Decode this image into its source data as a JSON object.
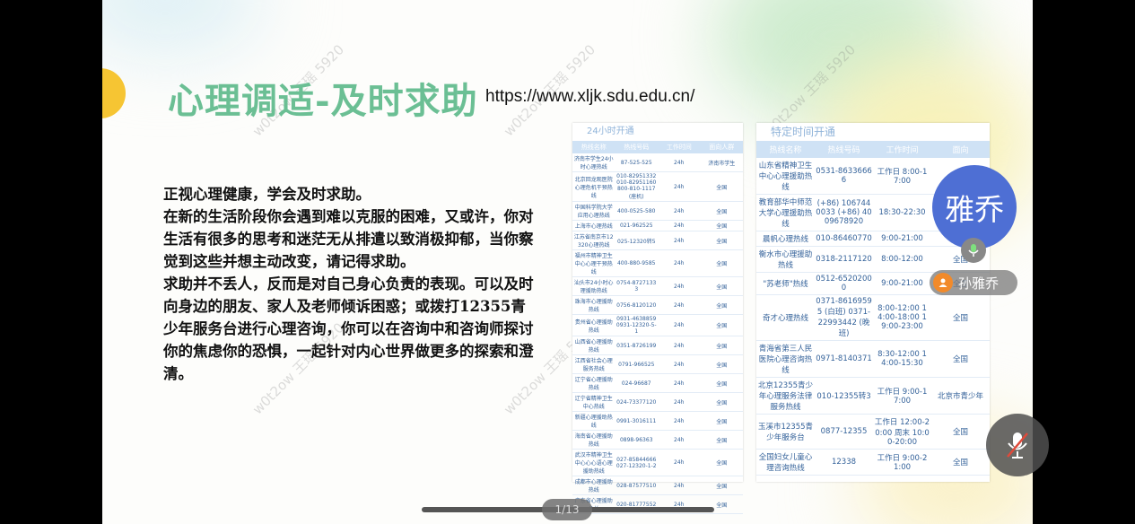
{
  "slide": {
    "title": "心理调适-及时求助",
    "url": "https://www.xljk.sdu.edu.cn/",
    "paragraphs": [
      "正视心理健康，学会及时求助。",
      "在新的生活阶段你会遇到难以克服的困难，又或许，你对生活有很多的思考和迷茫无从排遣以致消极抑郁，当你察觉到这些并想主动改变，请记得求助。",
      "求助并不丢人，反而是对自己身心负责的表现。可以及时向身边的朋友、家人及老师倾诉困惑；或拨打12355青少年服务台进行心理咨询，你可以在咨询中和咨询师探讨你的焦虑你的恐惧，一起针对内心世界做更多的探索和澄清。"
    ],
    "watermark": "w0t2ow 王瑶 5920"
  },
  "table1": {
    "heading": "24小时开通",
    "headers": [
      "热线名称",
      "热线号码",
      "工作时间",
      "面向人群"
    ],
    "rows": [
      [
        "济南市学生24小时心理热线",
        "87-525-525",
        "24h",
        "济南市学生"
      ],
      [
        "北京回龙观医院心理危机干预热线",
        "010-82951332 010-82951160 800-810-1117(座机)",
        "24h",
        "全国"
      ],
      [
        "中国科学院大学应用心理热线",
        "400-0525-580",
        "24h",
        "全国"
      ],
      [
        "上海市心理热线",
        "021-962525",
        "24h",
        "全国"
      ],
      [
        "江苏省南京市12320心理热线",
        "025-12320转5",
        "24h",
        "全国"
      ],
      [
        "福州市精神卫生中心心理干预热线",
        "400-880-9585",
        "24h",
        "全国"
      ],
      [
        "汕头市24小时心理援助热线",
        "0754-87271333",
        "24h",
        "全国"
      ],
      [
        "珠海市心理援助热线",
        "0756-8120120",
        "24h",
        "全国"
      ],
      [
        "贵州省心理援助热线",
        "0931-4638859 0931-12320-5-1",
        "24h",
        "全国"
      ],
      [
        "山西省心理援助热线",
        "0351-8726199",
        "24h",
        "全国"
      ],
      [
        "江西省社会心理服务热线",
        "0791-966525",
        "24h",
        "全国"
      ],
      [
        "辽宁省心理援助热线",
        "024-96687",
        "24h",
        "全国"
      ],
      [
        "辽宁省精神卫生中心热线",
        "024-73377120",
        "24h",
        "全国"
      ],
      [
        "新疆心理援助热线",
        "0991-3016111",
        "24h",
        "全国"
      ],
      [
        "海南省心理援助热线",
        "0898-96363",
        "24h",
        "全国"
      ],
      [
        "武汉市精神卫生中心心心语心理援助热线",
        "027-85844666 027-12320-1-2",
        "24h",
        "全国"
      ],
      [
        "成都市心理援助热线",
        "028-87577510",
        "24h",
        "全国"
      ],
      [
        "广东省心理援助公益",
        "020-81777552",
        "24h",
        "全国"
      ]
    ]
  },
  "table2": {
    "heading": "特定时间开通",
    "headers": [
      "热线名称",
      "热线号码",
      "工作时间",
      "面向"
    ],
    "rows": [
      [
        "山东省精神卫生中心心理援助热线",
        "0531-86336666",
        "工作日 8:00-17:00",
        "全国"
      ],
      [
        "教育部华中师范大学心理援助热线",
        "(+86) 1067440033 (+86) 4009678920",
        "18:30-22:30",
        "全国"
      ],
      [
        "晨帆心理热线",
        "010-86460770",
        "9:00-21:00",
        "全国"
      ],
      [
        "衡水市心理援助热线",
        "0318-2117120",
        "8:00-12:00",
        "全国"
      ],
      [
        "\"苏老师\"热线",
        "0512-65202000",
        "9:00-21:00",
        "全国"
      ],
      [
        "奇才心理热线",
        "0371-86169595 (白班) 0371-22993442 (晚班)",
        "8:00-12:00 14:00-18:00 19:00-23:00",
        "全国"
      ],
      [
        "青海省第三人民医院心理咨询热线",
        "0971-8140371",
        "8:30-12:00 14:00-15:30",
        "全国"
      ],
      [
        "北京12355青少年心理服务法律服务热线",
        "010-12355转3",
        "工作日 9:00-17:00",
        "北京市青少年"
      ],
      [
        "玉溪市12355青少年服务台",
        "0877-12355",
        "工作日 12:00-20:00 周末 10:00-20:00",
        "全国"
      ],
      [
        "全国妇女儿童心理咨询热线",
        "12338",
        "工作日 9:00-21:00",
        "全国"
      ]
    ]
  },
  "overlay": {
    "avatar_text": "雅乔",
    "participant_name": "孙雅乔",
    "page_indicator": "1/13",
    "colors": {
      "avatar": "#4e6fd4",
      "person_badge": "#f28a2a",
      "title": "#6bbf94"
    }
  }
}
